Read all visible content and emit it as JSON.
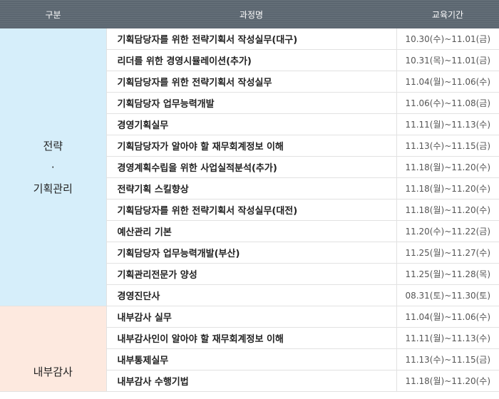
{
  "header": {
    "category": "구분",
    "course": "과정명",
    "period": "교육기간"
  },
  "groups": [
    {
      "category_line1": "전략",
      "category_dot": "·",
      "category_line2": "기획관리",
      "rows": [
        {
          "course": "기획담당자를 위한 전략기획서 작성실무(대구)",
          "period": "10.30(수)~11.01(금)"
        },
        {
          "course": "리더를 위한 경영시뮬레이션(추가)",
          "period": "10.31(목)~11.01(금)"
        },
        {
          "course": "기획담당자를 위한 전략기획서 작성실무",
          "period": "11.04(월)~11.06(수)"
        },
        {
          "course": "기획담당자 업무능력개발",
          "period": "11.06(수)~11.08(금)"
        },
        {
          "course": "경영기획실무",
          "period": "11.11(월)~11.13(수)"
        },
        {
          "course": "기획담당자가 알아야 할 재무회계정보 이해",
          "period": "11.13(수)~11.15(금)"
        },
        {
          "course": "경영계획수립을 위한 사업실적분석(추가)",
          "period": "11.18(월)~11.20(수)"
        },
        {
          "course": "전략기획 스킬향상",
          "period": "11.18(월)~11.20(수)"
        },
        {
          "course": "기획담당자를 위한 전략기획서 작성실무(대전)",
          "period": "11.18(월)~11.20(수)"
        },
        {
          "course": "예산관리 기본",
          "period": "11.20(수)~11.22(금)"
        },
        {
          "course": "기획담당자 업무능력개발(부산)",
          "period": "11.25(월)~11.27(수)"
        },
        {
          "course": "기획관리전문가 양성",
          "period": "11.25(월)~11.28(목)"
        },
        {
          "course": "경영진단사",
          "period": "08.31(토)~11.30(토)"
        }
      ]
    },
    {
      "category_line1": "내부감사",
      "rows": [
        {
          "course": "내부감사 실무",
          "period": "11.04(월)~11.06(수)"
        },
        {
          "course": "내부감사인이 알아야 할 재무회계정보 이해",
          "period": "11.11(월)~11.13(수)"
        },
        {
          "course": "내부통제실무",
          "period": "11.13(수)~11.15(금)"
        },
        {
          "course": "내부감사 수행기법",
          "period": "11.18(월)~11.20(수)"
        }
      ]
    }
  ],
  "colors": {
    "header_bg": "#5b6670",
    "strategy_bg": "#d6eefa",
    "audit_bg": "#fde9df"
  }
}
